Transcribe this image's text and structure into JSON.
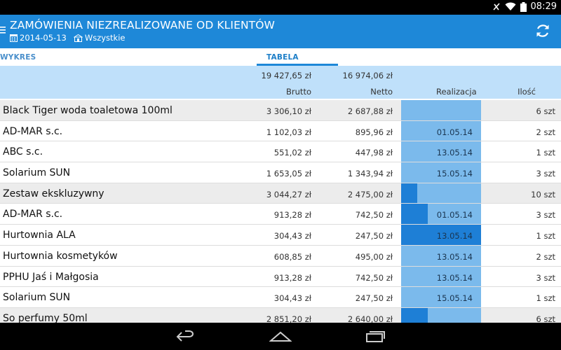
{
  "status": {
    "time": "08:29"
  },
  "action_bar": {
    "title": "ZAMÓWIENIA NIEZREALIZOWANE OD KLIENTÓW",
    "date": "2014-05-13",
    "store": "Wszystkie"
  },
  "tabs": [
    {
      "label": "WYKRES",
      "selected": false
    },
    {
      "label": "TABELA",
      "selected": true
    }
  ],
  "summary": {
    "brutto_total": "19 427,65 zł",
    "netto_total": "16 974,06 zł"
  },
  "columns": {
    "brutto": "Brutto",
    "netto": "Netto",
    "realizacja": "Realizacja",
    "ilosc": "Ilość"
  },
  "rows": [
    {
      "name": "Black Tiger woda toaletowa 100ml",
      "brutto": "3 306,10 zł",
      "netto": "2 687,88 zł",
      "date": "",
      "progress": 0.0,
      "qty": "6 szt",
      "group": true
    },
    {
      "name": "AD-MAR s.c.",
      "brutto": "1 102,03 zł",
      "netto": "895,96 zł",
      "date": "01.05.14",
      "progress": 0.0,
      "qty": "2 szt",
      "group": false
    },
    {
      "name": "ABC s.c.",
      "brutto": "551,02 zł",
      "netto": "447,98 zł",
      "date": "13.05.14",
      "progress": 0.0,
      "qty": "1 szt",
      "group": false
    },
    {
      "name": "Solarium SUN",
      "brutto": "1 653,05 zł",
      "netto": "1 343,94 zł",
      "date": "15.05.14",
      "progress": 0.0,
      "qty": "3 szt",
      "group": false
    },
    {
      "name": "Zestaw ekskluzywny",
      "brutto": "3 044,27 zł",
      "netto": "2 475,00 zł",
      "date": "",
      "progress": 0.2,
      "qty": "10 szt",
      "group": true
    },
    {
      "name": "AD-MAR s.c.",
      "brutto": "913,28 zł",
      "netto": "742,50 zł",
      "date": "01.05.14",
      "progress": 0.33,
      "qty": "3 szt",
      "group": false
    },
    {
      "name": "Hurtownia ALA",
      "brutto": "304,43 zł",
      "netto": "247,50 zł",
      "date": "13.05.14",
      "progress": 1.0,
      "qty": "1 szt",
      "group": false
    },
    {
      "name": "Hurtownia kosmetyków",
      "brutto": "608,85 zł",
      "netto": "495,00 zł",
      "date": "13.05.14",
      "progress": 0.0,
      "qty": "2 szt",
      "group": false
    },
    {
      "name": "PPHU Jaś i Małgosia",
      "brutto": "913,28 zł",
      "netto": "742,50 zł",
      "date": "13.05.14",
      "progress": 0.0,
      "qty": "3 szt",
      "group": false
    },
    {
      "name": "Solarium SUN",
      "brutto": "304,43 zł",
      "netto": "247,50 zł",
      "date": "15.05.14",
      "progress": 0.0,
      "qty": "1 szt",
      "group": false
    },
    {
      "name": "So perfumy 50ml",
      "brutto": "2 851,20 zł",
      "netto": "2 640,00 zł",
      "date": "",
      "progress": 0.33,
      "qty": "6 szt",
      "group": true
    }
  ],
  "colors": {
    "action_bar": "#1e88d8",
    "header_bg": "#bfe0fa",
    "progress_bg": "#7bbaec",
    "progress_fill": "#1e7fd6"
  },
  "icons": [
    "menu-icon",
    "calendar-icon",
    "store-icon",
    "refresh-icon",
    "wifi-icon",
    "battery-icon",
    "back-icon",
    "home-icon",
    "recent-apps-icon"
  ]
}
